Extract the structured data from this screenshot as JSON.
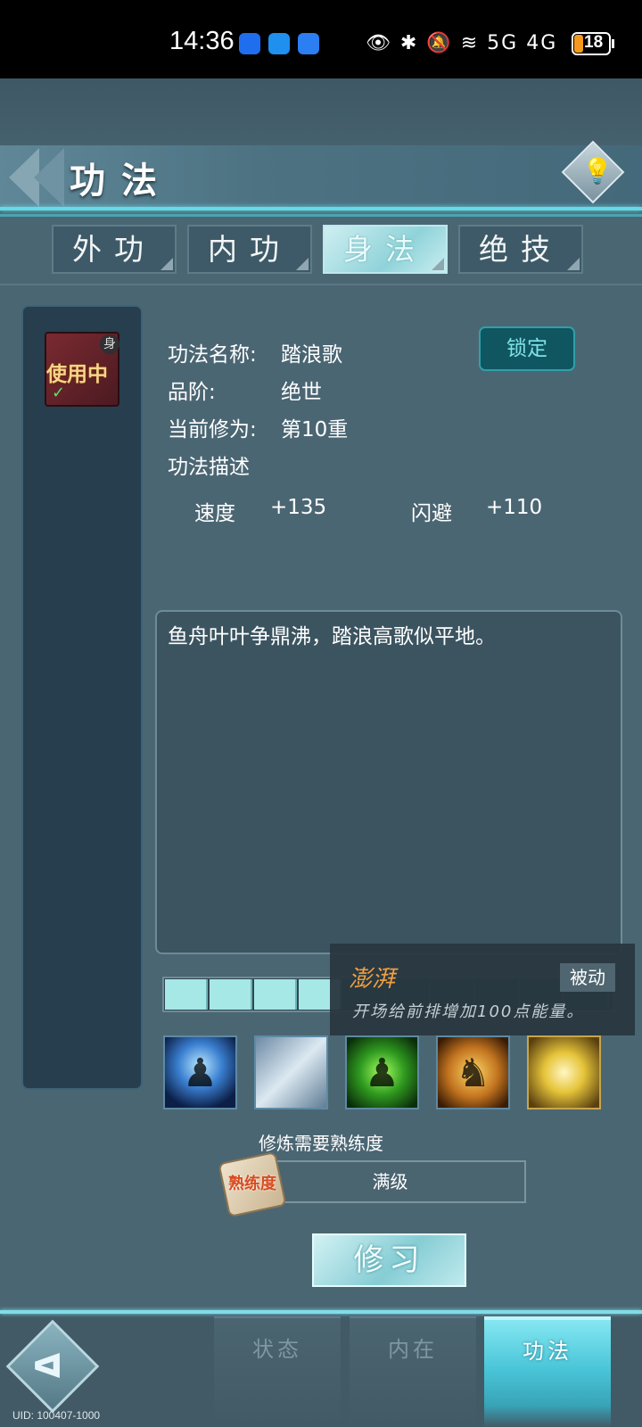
{
  "status_bar": {
    "time": "14:36",
    "signal_icons": "👁 ✱ 🔕 ≋ 5G 4G",
    "battery": "18"
  },
  "header": {
    "title": "功法"
  },
  "tabs": [
    {
      "label": "外功"
    },
    {
      "label": "内功"
    },
    {
      "label": "身法"
    },
    {
      "label": "绝技"
    }
  ],
  "skill_slot": {
    "badge": "身",
    "status": "使用中",
    "check": "✓"
  },
  "info": {
    "name_label": "功法名称:",
    "name_value": "踏浪歌",
    "grade_label": "品阶:",
    "grade_value": "绝世",
    "level_label": "当前修为:",
    "level_value": "第10重",
    "desc_label": "功法描述",
    "lock_button": "锁定"
  },
  "stats": [
    {
      "name": "速度",
      "value": "+135"
    },
    {
      "name": "闪避",
      "value": "+110"
    }
  ],
  "description": "鱼舟叶叶争鼎沸，踏浪高歌似平地。",
  "progress": {
    "filled_segments": 4,
    "total_segments": 10
  },
  "tooltip": {
    "name": "澎湃",
    "tag": "被动",
    "desc": "开场给前排增加100点能量。"
  },
  "skills": [
    {
      "icon": "shadow-warrior-icon"
    },
    {
      "icon": "blade-slash-icon"
    },
    {
      "icon": "green-aura-icon"
    },
    {
      "icon": "horse-rider-icon"
    },
    {
      "icon": "golden-swirl-icon"
    }
  ],
  "training": {
    "label": "修炼需要熟练度",
    "scroll_text": "熟练度",
    "value": "满级"
  },
  "learn_button": "修习",
  "bottom_nav": [
    {
      "label": "状态"
    },
    {
      "label": "内在"
    },
    {
      "label": "功法"
    }
  ],
  "uid": "UID: 100407-1000"
}
